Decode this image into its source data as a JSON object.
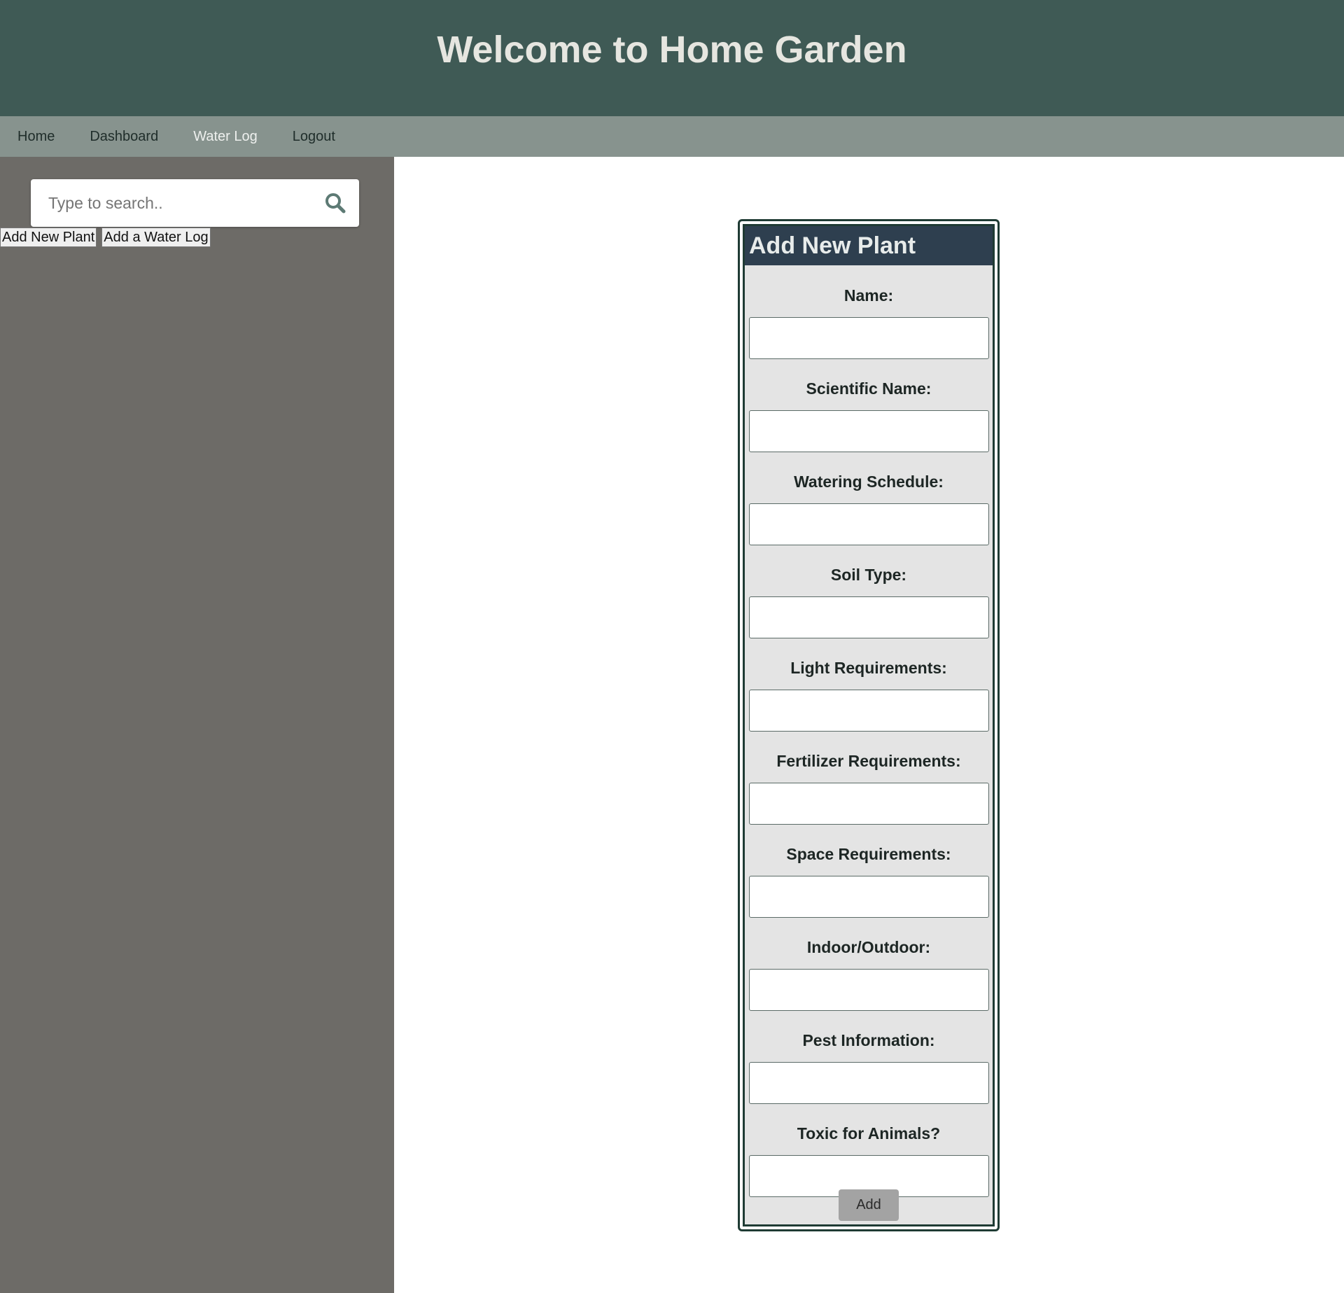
{
  "header": {
    "title": "Welcome to Home Garden"
  },
  "nav": {
    "items": [
      {
        "label": "Home"
      },
      {
        "label": "Dashboard"
      },
      {
        "label": "Water Log"
      },
      {
        "label": "Logout"
      }
    ]
  },
  "sidebar": {
    "search": {
      "placeholder": "Type to search..",
      "value": "",
      "icon": "search-icon"
    },
    "buttons": [
      {
        "label": "Add New Plant"
      },
      {
        "label": "Add a Water Log"
      }
    ]
  },
  "form": {
    "title": "Add New Plant",
    "fields": [
      {
        "label": "Name:",
        "value": ""
      },
      {
        "label": "Scientific Name:",
        "value": ""
      },
      {
        "label": "Watering Schedule:",
        "value": ""
      },
      {
        "label": "Soil Type:",
        "value": ""
      },
      {
        "label": "Light Requirements:",
        "value": ""
      },
      {
        "label": "Fertilizer Requirements:",
        "value": ""
      },
      {
        "label": "Space Requirements:",
        "value": ""
      },
      {
        "label": "Indoor/Outdoor:",
        "value": ""
      },
      {
        "label": "Pest Information:",
        "value": ""
      },
      {
        "label": "Toxic for Animals?",
        "value": ""
      }
    ],
    "submit_label": "Add"
  },
  "colors": {
    "header_bg": "#3f5a55",
    "nav_bg": "#87938e",
    "sidebar_bg": "#6d6b67",
    "form_title_bg": "#2e3f4f",
    "form_bg": "#e4e4e4",
    "search_icon": "#5d7a74"
  }
}
